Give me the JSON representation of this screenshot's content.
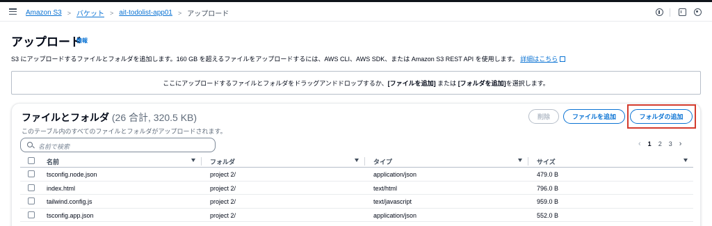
{
  "breadcrumb": {
    "items": [
      "Amazon S3",
      "バケット",
      "ait-todolist-app01"
    ],
    "current": "アップロード"
  },
  "page": {
    "title": "アップロード",
    "info_link": "情報",
    "description": "S3 にアップロードするファイルとフォルダを追加します。160 GB を超えるファイルをアップロードするには、AWS CLI、AWS SDK、または Amazon S3 REST API を使用します。",
    "description_link": "詳細はこちら"
  },
  "dropzone": {
    "part1": "ここにアップロードするファイルとフォルダをドラッグアンドドロップするか、",
    "bold1": "[ファイルを追加]",
    "part2": " または ",
    "bold2": "[フォルダを追加]",
    "part3": " を選択します。"
  },
  "panel": {
    "title": "ファイルとフォルダ",
    "count": "(26 合計, 320.5 KB)",
    "subtitle": "このテーブル内のすべてのファイルとフォルダがアップロードされます。",
    "delete_label": "削除",
    "add_file_label": "ファイルを追加",
    "add_folder_label": "フォルダの追加",
    "search_placeholder": "名前で検索"
  },
  "pagination": {
    "pages": [
      "1",
      "2",
      "3"
    ],
    "current": "1"
  },
  "table": {
    "headers": [
      "名前",
      "フォルダ",
      "タイプ",
      "サイズ"
    ],
    "rows": [
      [
        "tsconfig.node.json",
        "project 2/",
        "application/json",
        "479.0 B"
      ],
      [
        "index.html",
        "project 2/",
        "text/html",
        "796.0 B"
      ],
      [
        "tailwind.config.js",
        "project 2/",
        "text/javascript",
        "959.0 B"
      ],
      [
        "tsconfig.app.json",
        "project 2/",
        "application/json",
        "552.0 B"
      ]
    ]
  },
  "colors": {
    "link": "#0972d3",
    "highlight": "#d33a2c",
    "text": "#000716"
  }
}
